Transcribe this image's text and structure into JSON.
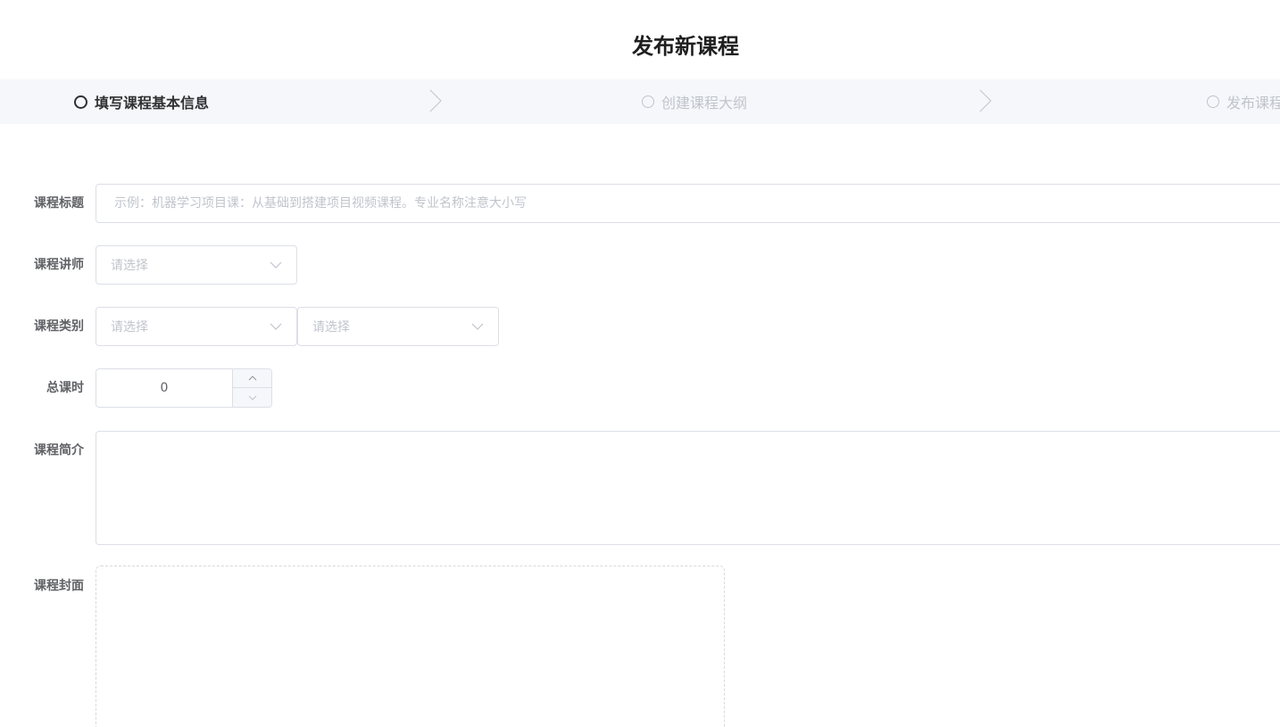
{
  "page": {
    "title": "发布新课程"
  },
  "steps": [
    {
      "label": "填写课程基本信息",
      "active": true
    },
    {
      "label": "创建课程大纲",
      "active": false
    },
    {
      "label": "发布课程",
      "active": false
    }
  ],
  "form": {
    "title_field": {
      "label": "课程标题",
      "value": "",
      "placeholder": "示例：机器学习项目课：从基础到搭建项目视频课程。专业名称注意大小写"
    },
    "teacher_field": {
      "label": "课程讲师",
      "placeholder": "请选择"
    },
    "category_field": {
      "label": "课程类别",
      "level1_placeholder": "请选择",
      "level2_placeholder": "请选择"
    },
    "lesson_num_field": {
      "label": "总课时",
      "value": "0"
    },
    "description_field": {
      "label": "课程简介",
      "value": ""
    },
    "cover_field": {
      "label": "课程封面"
    }
  },
  "colors": {
    "steps_bg": "#f5f7fa",
    "active_step": "#303133",
    "inactive_step": "#c0c4cc",
    "border": "#dcdfe6",
    "placeholder": "#c0c4cc",
    "label": "#606266"
  },
  "icons": {
    "step_circle": "circle-outline-icon",
    "step_separator": "chevron-right-icon",
    "select_arrow": "chevron-down-icon",
    "stepper_up": "chevron-up-icon",
    "stepper_down": "chevron-down-icon"
  }
}
